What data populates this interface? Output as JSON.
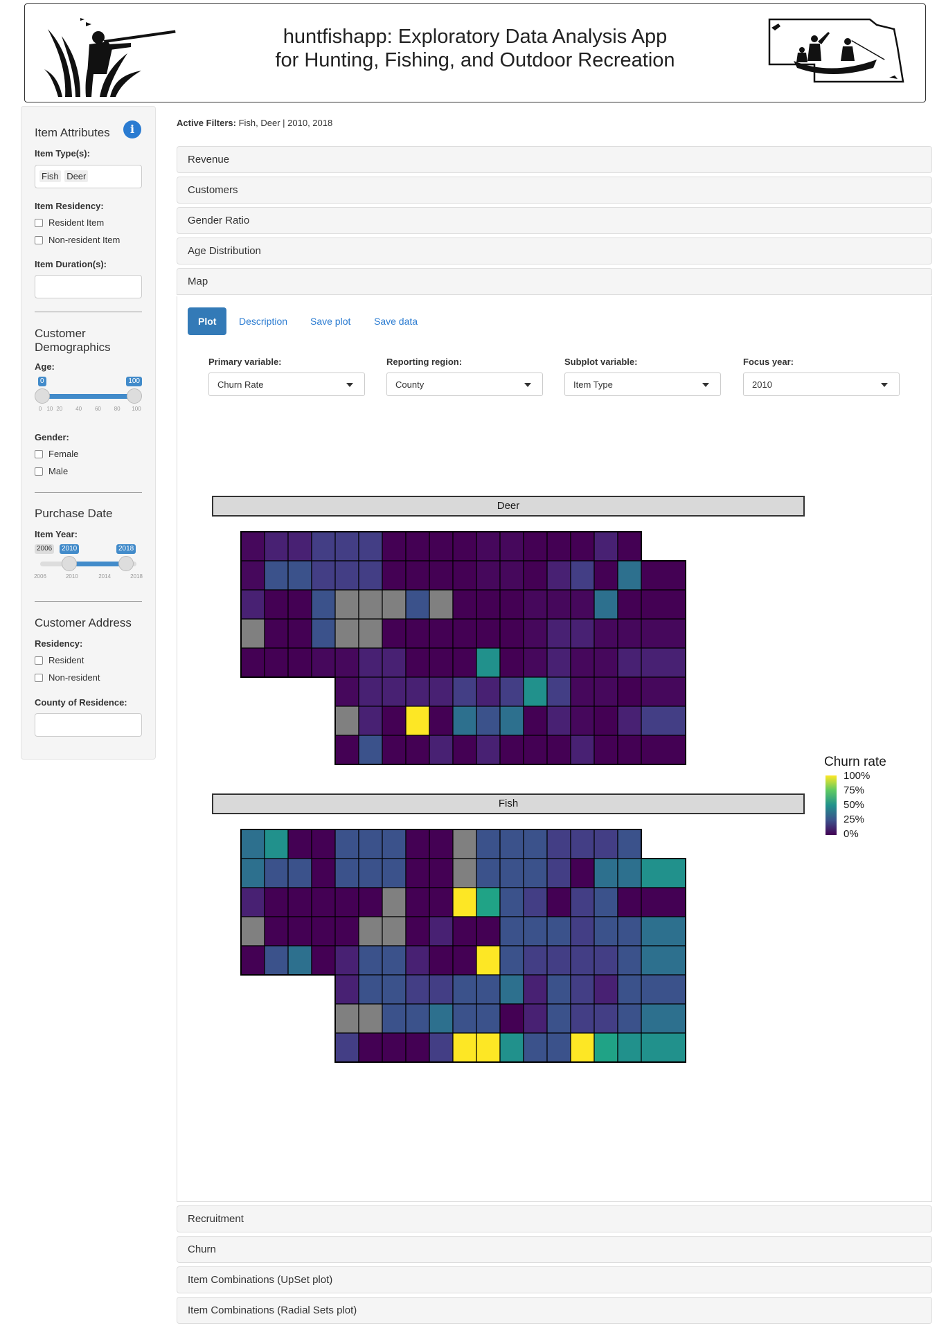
{
  "header": {
    "title_line1": "huntfishapp: Exploratory Data Analysis App",
    "title_line2": "for Hunting, Fishing, and Outdoor Recreation"
  },
  "sidebar": {
    "item_attributes": {
      "title": "Item Attributes",
      "info_glyph": "i",
      "item_types_label": "Item Type(s):",
      "item_types": [
        "Fish",
        "Deer"
      ],
      "residency_label": "Item Residency:",
      "residency_options": [
        "Resident Item",
        "Non-resident Item"
      ],
      "duration_label": "Item Duration(s):"
    },
    "demographics": {
      "title_line1": "Customer",
      "title_line2": "Demographics",
      "age_label": "Age:",
      "age_min": "0",
      "age_max": "100",
      "age_ticks": [
        "0",
        "10",
        "20",
        "40",
        "60",
        "80",
        "100"
      ],
      "gender_label": "Gender:",
      "gender_options": [
        "Female",
        "Male"
      ]
    },
    "purchase_date": {
      "title": "Purchase Date",
      "year_label": "Item Year:",
      "year_range_min": "2006",
      "year_from": "2010",
      "year_to": "2018",
      "year_ticks": [
        "2006",
        "2010",
        "2014",
        "2018"
      ]
    },
    "address": {
      "title": "Customer Address",
      "residency_label": "Residency:",
      "residency_options": [
        "Resident",
        "Non-resident"
      ],
      "county_label": "County of Residence:"
    }
  },
  "main": {
    "filters_label": "Active Filters:",
    "filters_value": " Fish, Deer | 2010, 2018",
    "panels_top": [
      "Revenue",
      "Customers",
      "Gender Ratio",
      "Age Distribution",
      "Map"
    ],
    "panels_bottom": [
      "Recruitment",
      "Churn",
      "Item Combinations (UpSet plot)",
      "Item Combinations (Radial Sets plot)"
    ],
    "tabs": [
      "Plot",
      "Description",
      "Save plot",
      "Save data"
    ],
    "selects": [
      {
        "label": "Primary variable:",
        "value": "Churn Rate"
      },
      {
        "label": "Reporting region:",
        "value": "County"
      },
      {
        "label": "Subplot variable:",
        "value": "Item Type"
      },
      {
        "label": "Focus year:",
        "value": "2010"
      }
    ]
  },
  "chart_data": {
    "type": "heatmap",
    "facets": [
      "Deer",
      "Fish"
    ],
    "legend_title": "Churn rate",
    "legend_labels": [
      "100%",
      "75%",
      "50%",
      "25%",
      "0%"
    ],
    "colors": {
      "low": "#440154",
      "mid": "#21918c",
      "high": "#fde725",
      "missing": "#808080"
    }
  }
}
